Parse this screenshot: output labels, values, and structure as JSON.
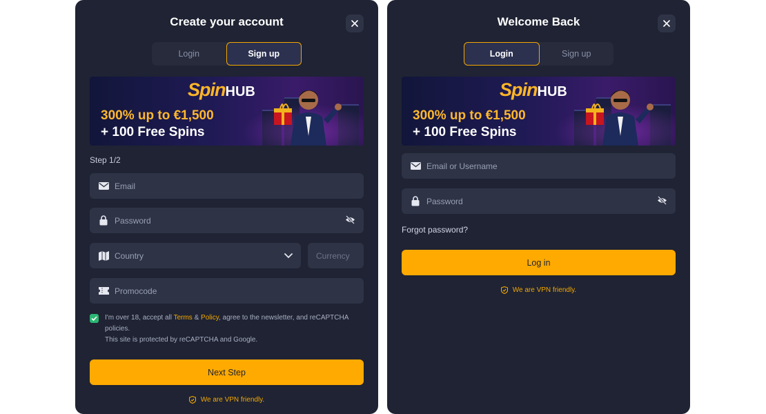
{
  "signup": {
    "title": "Create your account",
    "tabs": [
      {
        "label": "Login"
      },
      {
        "label": "Sign up"
      }
    ],
    "active_tab": "Sign up",
    "banner": {
      "brand_spin": "Spin",
      "brand_hub": "HUB",
      "promo_line1": "300% up to €1,500",
      "promo_line2": "+ 100 Free Spins"
    },
    "step_label": "Step 1/2",
    "fields": {
      "email_placeholder": "Email",
      "password_placeholder": "Password",
      "country_placeholder": "Country",
      "currency_placeholder": "Currency",
      "promocode_placeholder": "Promocode"
    },
    "consent": {
      "checked": true,
      "text_before": "I'm over 18, accept all ",
      "terms_link": "Terms",
      "amp": " & ",
      "policy_link": "Policy",
      "text_after": ", agree to the newsletter, and reCAPTCHA policies.",
      "recaptcha_note": "This site is protected by reCAPTCHA and Google."
    },
    "next_button": "Next Step",
    "vpn_note": "We are VPN friendly."
  },
  "login": {
    "title": "Welcome Back",
    "tabs": [
      {
        "label": "Login"
      },
      {
        "label": "Sign up"
      }
    ],
    "active_tab": "Login",
    "banner": {
      "brand_spin": "Spin",
      "brand_hub": "HUB",
      "promo_line1": "300% up to €1,500",
      "promo_line2": "+ 100 Free Spins"
    },
    "fields": {
      "username_placeholder": "Email or Username",
      "password_placeholder": "Password"
    },
    "forgot_link": "Forgot password?",
    "login_button": "Log in",
    "vpn_note": "We are VPN friendly."
  },
  "colors": {
    "panel_bg": "#1f2333",
    "input_bg": "#2e3346",
    "accent": "#ffaa00",
    "check_green": "#2bb673"
  },
  "icons": [
    "close-icon",
    "mail-icon",
    "lock-icon",
    "eye-off-icon",
    "map-icon",
    "chevron-down-icon",
    "ticket-icon",
    "check-icon",
    "shield-icon"
  ]
}
